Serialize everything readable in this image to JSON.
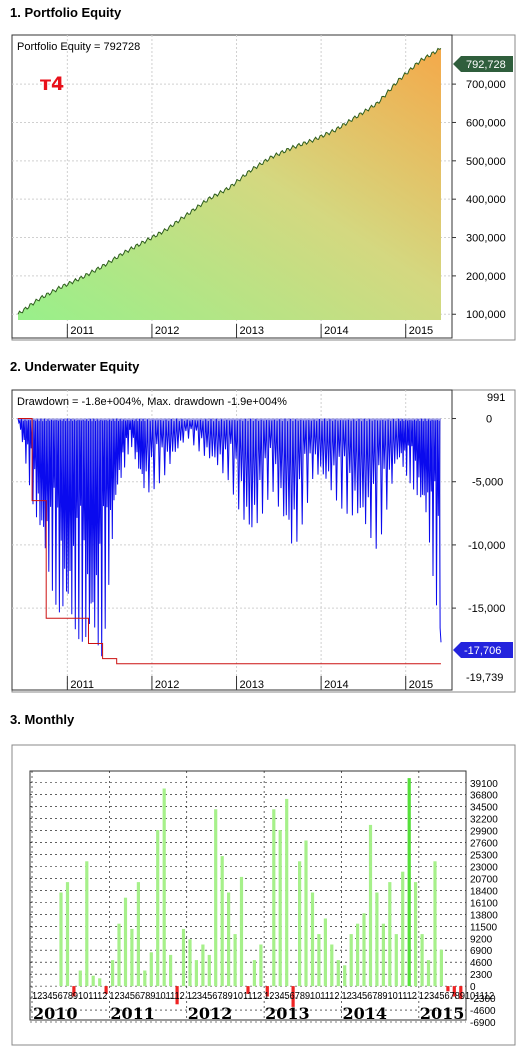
{
  "sections": [
    {
      "title": "1. Portfolio Equity"
    },
    {
      "title": "2. Underwater Equity"
    },
    {
      "title": "3. Monthly"
    }
  ],
  "equity": {
    "caption": "Portfolio Equity = 792728",
    "tag": "т4",
    "last_value_label": "792,728",
    "y_ticks": [
      "700,000",
      "600,000",
      "500,000",
      "400,000",
      "300,000",
      "200,000",
      "100,000"
    ],
    "x_ticks": [
      "2011",
      "2012",
      "2013",
      "2014",
      "2015"
    ],
    "colors": {
      "fill_low": "#98f08a",
      "fill_high": "#f4a94a",
      "line": "#2e5e1e",
      "tag": "#e8101a",
      "badge": "#2f5e3c"
    }
  },
  "underwater": {
    "caption": "Drawdown = -1.8e+004%, Max. drawdown -1.9e+004%",
    "top_label": "991",
    "y_ticks": [
      "0",
      "-5,000",
      "-10,000",
      "-15,000"
    ],
    "bottom_label": "-19,739",
    "last_value_label": "-17,706",
    "x_ticks": [
      "2011",
      "2012",
      "2013",
      "2014",
      "2015"
    ],
    "colors": {
      "drawdown": "#0a0aee",
      "max_line": "#cc1111",
      "badge": "#2424dd"
    }
  },
  "monthly": {
    "y_ticks": [
      "39100",
      "36800",
      "34500",
      "32200",
      "29900",
      "27600",
      "25300",
      "23000",
      "20700",
      "18400",
      "16100",
      "13800",
      "11500",
      "9200",
      "6900",
      "4600",
      "2300",
      "0",
      "-2300",
      "-4600",
      "-6900"
    ],
    "month_digits": "123456789101112",
    "year_labels": [
      "2010",
      "2011",
      "2012",
      "2013",
      "2014",
      "2015"
    ],
    "colors": {
      "positive": "#a6f08a",
      "max": "#55e03a",
      "negative": "#ee2222"
    }
  },
  "chart_data": [
    {
      "type": "area",
      "title": "Portfolio Equity = 792728",
      "x": [
        "2010-06",
        "2010-09",
        "2010-12",
        "2011-03",
        "2011-06",
        "2011-09",
        "2011-12",
        "2012-03",
        "2012-06",
        "2012-09",
        "2012-12",
        "2013-03",
        "2013-06",
        "2013-09",
        "2013-12",
        "2014-03",
        "2014-06",
        "2014-09",
        "2014-12",
        "2015-03",
        "2015-06"
      ],
      "series": [
        {
          "values": [
            100000,
            140000,
            170000,
            195000,
            225000,
            260000,
            290000,
            320000,
            360000,
            400000,
            430000,
            475000,
            510000,
            535000,
            555000,
            580000,
            615000,
            650000,
            710000,
            760000,
            792728
          ]
        }
      ],
      "ylim": [
        85000,
        815000
      ]
    },
    {
      "type": "line",
      "title": "Drawdown = -1.8e+004%, Max. drawdown -1.9e+004%",
      "x": [
        "2010-06",
        "2010-08",
        "2010-10",
        "2010-12",
        "2011-02",
        "2011-04",
        "2011-06",
        "2011-08",
        "2011-10",
        "2011-12",
        "2012-03",
        "2012-06",
        "2012-09",
        "2012-12",
        "2013-03",
        "2013-06",
        "2013-09",
        "2013-12",
        "2014-03",
        "2014-06",
        "2014-09",
        "2014-12",
        "2015-02",
        "2015-04",
        "2015-06"
      ],
      "series": [
        {
          "values": [
            0,
            -6500,
            -12000,
            -16000,
            -17000,
            -18500,
            -19000,
            -6500,
            -2000,
            -6500,
            -4500,
            -1500,
            -3500,
            -5000,
            -10500,
            -5500,
            -11500,
            -4500,
            -6500,
            -8500,
            -10500,
            -3500,
            -5500,
            -8500,
            -17706
          ]
        },
        {
          "values": [
            0,
            -6500,
            -15800,
            -15800,
            -15800,
            -17800,
            -19000,
            -19400,
            -19400,
            -19400,
            -19400,
            -19400,
            -19400,
            -19400,
            -19400,
            -19400,
            -19400,
            -19400,
            -19400,
            -19400,
            -19400,
            -19400,
            -19400,
            -19400,
            -19400
          ]
        }
      ],
      "ylim": [
        -19739,
        991
      ]
    },
    {
      "type": "bar",
      "categories": [
        "2010-01",
        "2010-02",
        "2010-03",
        "2010-04",
        "2010-05",
        "2010-06",
        "2010-07",
        "2010-08",
        "2010-09",
        "2010-10",
        "2010-11",
        "2010-12",
        "2011-01",
        "2011-02",
        "2011-03",
        "2011-04",
        "2011-05",
        "2011-06",
        "2011-07",
        "2011-08",
        "2011-09",
        "2011-10",
        "2011-11",
        "2011-12",
        "2012-01",
        "2012-02",
        "2012-03",
        "2012-04",
        "2012-05",
        "2012-06",
        "2012-07",
        "2012-08",
        "2012-09",
        "2012-10",
        "2012-11",
        "2012-12",
        "2013-01",
        "2013-02",
        "2013-03",
        "2013-04",
        "2013-05",
        "2013-06",
        "2013-07",
        "2013-08",
        "2013-09",
        "2013-10",
        "2013-11",
        "2013-12",
        "2014-01",
        "2014-02",
        "2014-03",
        "2014-04",
        "2014-05",
        "2014-06",
        "2014-07",
        "2014-08",
        "2014-09",
        "2014-10",
        "2014-11",
        "2014-12",
        "2015-01",
        "2015-02",
        "2015-03",
        "2015-04",
        "2015-05",
        "2015-06",
        "2015-07"
      ],
      "values": [
        0,
        0,
        0,
        0,
        18000,
        20000,
        -2000,
        3000,
        24000,
        2000,
        1500,
        -1500,
        5000,
        12000,
        17000,
        11000,
        20000,
        3000,
        6500,
        30000,
        38000,
        6000,
        -3500,
        11000,
        9000,
        5000,
        8000,
        6000,
        34000,
        25000,
        18000,
        10000,
        21000,
        -1500,
        5000,
        8000,
        -2000,
        34000,
        30000,
        36000,
        -4000,
        24000,
        28000,
        18000,
        10000,
        13000,
        8000,
        5000,
        4000,
        10000,
        12000,
        14000,
        31000,
        18000,
        12000,
        20000,
        10000,
        22000,
        40000,
        20000,
        10000,
        5000,
        24000,
        7000,
        -1000,
        -2000,
        -2500
      ],
      "ylim": [
        -6900,
        40400
      ]
    }
  ]
}
